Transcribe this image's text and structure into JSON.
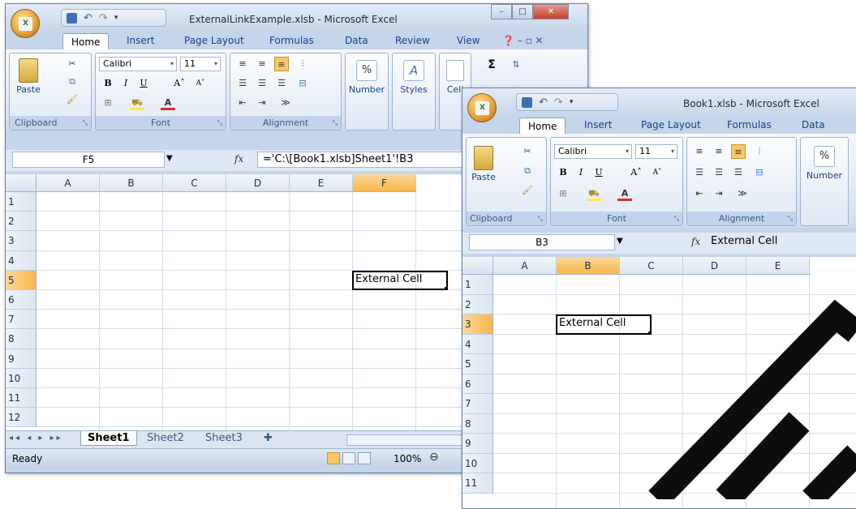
{
  "window1": {
    "title": "ExternalLinkExample.xlsb - Microsoft Excel",
    "tabs": [
      "Home",
      "Insert",
      "Page Layout",
      "Formulas",
      "Data",
      "Review",
      "View"
    ],
    "font_name": "Calibri",
    "font_size": "11",
    "groups": {
      "clipboard": "Clipboard",
      "font": "Font",
      "alignment": "Alignment"
    },
    "paste_label": "Paste",
    "number_label": "Number",
    "styles_label": "Styles",
    "cells_label": "Cell",
    "name_box": "F5",
    "formula": "='C:\\[Book1.xlsb]Sheet1'!B3",
    "columns": [
      "A",
      "B",
      "C",
      "D",
      "E",
      "F"
    ],
    "rows": [
      "1",
      "2",
      "3",
      "4",
      "5",
      "6",
      "7",
      "8",
      "9",
      "10",
      "11",
      "12"
    ],
    "cell_text": "External Cell",
    "sheets": [
      "Sheet1",
      "Sheet2",
      "Sheet3"
    ],
    "status": "Ready",
    "zoom": "100%"
  },
  "window2": {
    "title": "Book1.xlsb - Microsoft Excel",
    "tabs": [
      "Home",
      "Insert",
      "Page Layout",
      "Formulas",
      "Data"
    ],
    "font_name": "Calibri",
    "font_size": "11",
    "groups": {
      "clipboard": "Clipboard",
      "font": "Font",
      "alignment": "Alignment"
    },
    "paste_label": "Paste",
    "number_label": "Number",
    "name_box": "B3",
    "formula": "External Cell",
    "columns": [
      "A",
      "B",
      "C",
      "D",
      "E"
    ],
    "rows": [
      "1",
      "2",
      "3",
      "4",
      "5",
      "6",
      "7",
      "8",
      "9",
      "10",
      "11"
    ],
    "cell_text": "External Cell"
  },
  "colors": {
    "selected_header": "#f8b74a",
    "ribbon_blue": "#c5d5ea",
    "text_blue": "#15428b"
  }
}
